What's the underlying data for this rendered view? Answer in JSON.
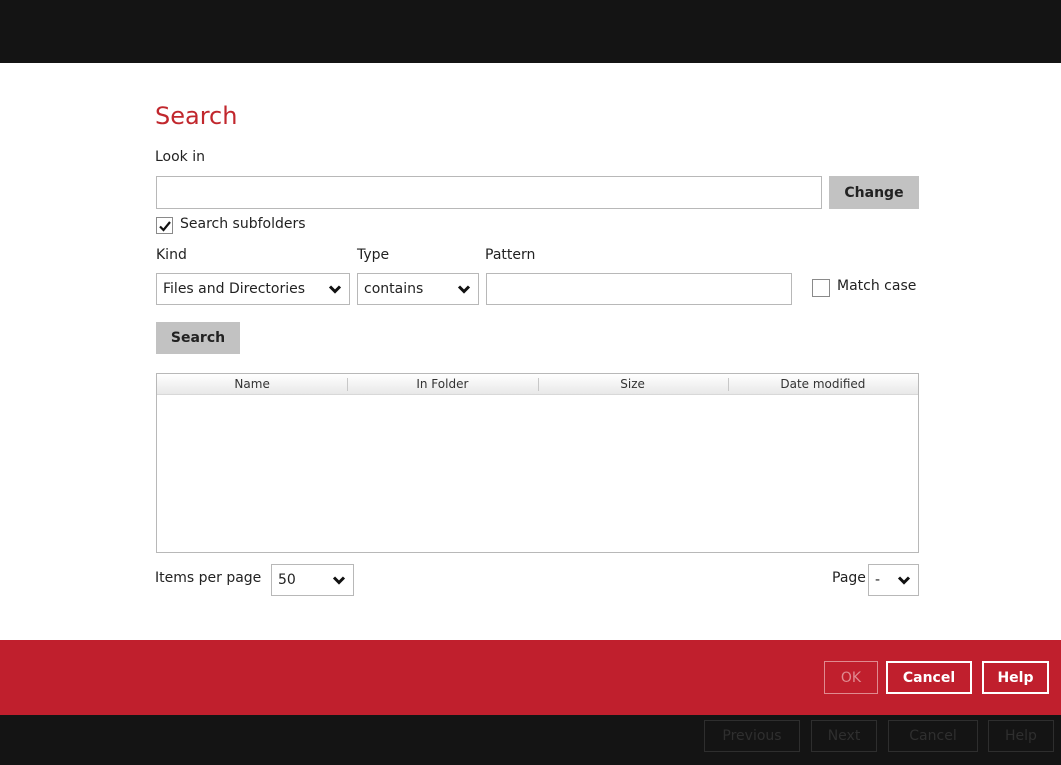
{
  "dialog": {
    "title": "Search",
    "look_in": {
      "label": "Look in",
      "value": "",
      "change_label": "Change"
    },
    "search_subfolders": {
      "label": "Search subfolders",
      "checked": true
    },
    "kind": {
      "label": "Kind",
      "selected": "Files and Directories"
    },
    "type": {
      "label": "Type",
      "selected": "contains"
    },
    "pattern": {
      "label": "Pattern",
      "value": ""
    },
    "match_case": {
      "label": "Match case",
      "checked": false
    },
    "search_button_label": "Search",
    "results_table": {
      "columns": [
        "Name",
        "In Folder",
        "Size",
        "Date modified"
      ],
      "rows": []
    },
    "items_per_page": {
      "label": "Items per page",
      "selected": "50"
    },
    "page": {
      "label": "Page",
      "selected": "-"
    }
  },
  "footer": {
    "ok_label": "OK",
    "cancel_label": "Cancel",
    "help_label": "Help"
  },
  "background_buttons": {
    "previous": "Previous",
    "next": "Next",
    "cancel": "Cancel",
    "help": "Help"
  },
  "colors": {
    "accent": "#c01f2d",
    "title": "#c1272d",
    "dark_bar": "#141414",
    "gray_button": "#c2c2c2"
  }
}
